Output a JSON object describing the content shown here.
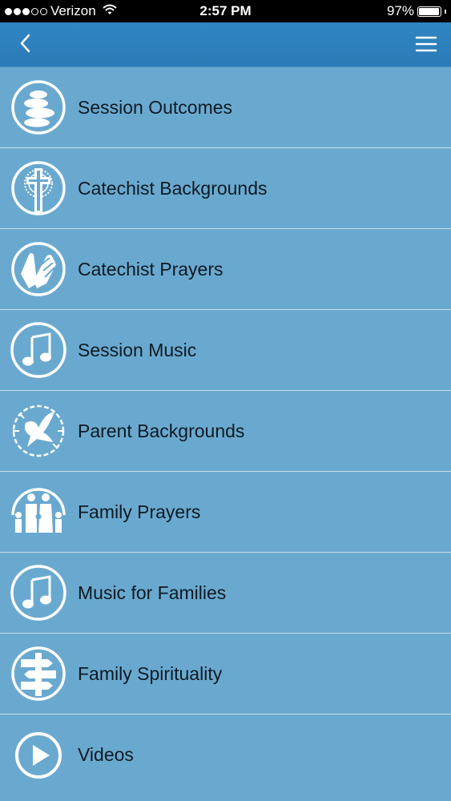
{
  "status_bar": {
    "carrier": "Verizon",
    "time": "2:57 PM",
    "battery": "97%",
    "battery_level": 0.97,
    "signal_bars_filled": 3,
    "signal_bars_total": 5
  },
  "nav": {
    "back_icon": "chevron-left-icon",
    "menu_icon": "hamburger-menu-icon"
  },
  "colors": {
    "status_bar_bg": "#000000",
    "nav_bg": "#2f86c3",
    "list_bg": "#6aa9cf",
    "divider": "#c7deef",
    "text": "#0e1a24",
    "icon": "#ffffff"
  },
  "menu_items": [
    {
      "label": "Session Outcomes",
      "icon": "stacked-stones-icon"
    },
    {
      "label": "Catechist Backgrounds",
      "icon": "sun-cross-icon"
    },
    {
      "label": "Catechist Prayers",
      "icon": "praying-hands-icon"
    },
    {
      "label": "Session Music",
      "icon": "music-note-icon"
    },
    {
      "label": "Parent Backgrounds",
      "icon": "dove-icon"
    },
    {
      "label": "Family Prayers",
      "icon": "family-icon"
    },
    {
      "label": "Music for Families",
      "icon": "music-note-icon"
    },
    {
      "label": "Family Spirituality",
      "icon": "signpost-icon"
    },
    {
      "label": "Videos",
      "icon": "play-icon"
    }
  ]
}
